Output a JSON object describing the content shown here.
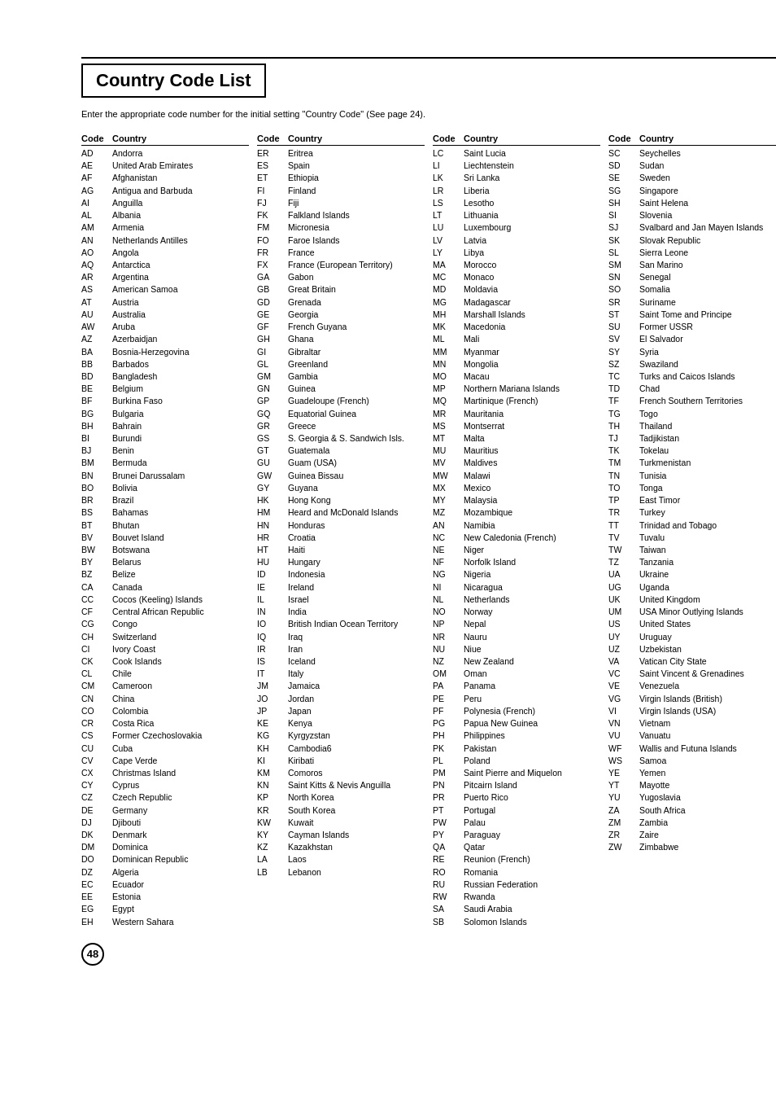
{
  "title": "Country Code List",
  "subtitle": "Enter the appropriate code number for the initial setting \"Country Code\" (See page 24).",
  "header": {
    "code": "Code",
    "country": "Country"
  },
  "page_number": "48",
  "col1": [
    {
      "code": "AD",
      "country": "Andorra"
    },
    {
      "code": "AE",
      "country": "United Arab Emirates"
    },
    {
      "code": "AF",
      "country": "Afghanistan"
    },
    {
      "code": "AG",
      "country": "Antigua and Barbuda"
    },
    {
      "code": "AI",
      "country": "Anguilla"
    },
    {
      "code": "AL",
      "country": "Albania"
    },
    {
      "code": "AM",
      "country": "Armenia"
    },
    {
      "code": "AN",
      "country": "Netherlands Antilles"
    },
    {
      "code": "AO",
      "country": "Angola"
    },
    {
      "code": "AQ",
      "country": "Antarctica"
    },
    {
      "code": "AR",
      "country": "Argentina"
    },
    {
      "code": "AS",
      "country": "American Samoa"
    },
    {
      "code": "AT",
      "country": "Austria"
    },
    {
      "code": "AU",
      "country": "Australia"
    },
    {
      "code": "AW",
      "country": "Aruba"
    },
    {
      "code": "AZ",
      "country": "Azerbaidjan"
    },
    {
      "code": "BA",
      "country": "Bosnia-Herzegovina"
    },
    {
      "code": "BB",
      "country": "Barbados"
    },
    {
      "code": "BD",
      "country": "Bangladesh"
    },
    {
      "code": "BE",
      "country": "Belgium"
    },
    {
      "code": "BF",
      "country": "Burkina Faso"
    },
    {
      "code": "BG",
      "country": "Bulgaria"
    },
    {
      "code": "BH",
      "country": "Bahrain"
    },
    {
      "code": "BI",
      "country": "Burundi"
    },
    {
      "code": "BJ",
      "country": "Benin"
    },
    {
      "code": "BM",
      "country": "Bermuda"
    },
    {
      "code": "BN",
      "country": "Brunei Darussalam"
    },
    {
      "code": "BO",
      "country": "Bolivia"
    },
    {
      "code": "BR",
      "country": "Brazil"
    },
    {
      "code": "BS",
      "country": "Bahamas"
    },
    {
      "code": "BT",
      "country": "Bhutan"
    },
    {
      "code": "BV",
      "country": "Bouvet Island"
    },
    {
      "code": "BW",
      "country": "Botswana"
    },
    {
      "code": "BY",
      "country": "Belarus"
    },
    {
      "code": "BZ",
      "country": "Belize"
    },
    {
      "code": "CA",
      "country": "Canada"
    },
    {
      "code": "CC",
      "country": "Cocos (Keeling) Islands"
    },
    {
      "code": "CF",
      "country": "Central African Republic"
    },
    {
      "code": "CG",
      "country": "Congo"
    },
    {
      "code": "CH",
      "country": "Switzerland"
    },
    {
      "code": "CI",
      "country": "Ivory Coast"
    },
    {
      "code": "CK",
      "country": "Cook Islands"
    },
    {
      "code": "CL",
      "country": "Chile"
    },
    {
      "code": "CM",
      "country": "Cameroon"
    },
    {
      "code": "CN",
      "country": "China"
    },
    {
      "code": "CO",
      "country": "Colombia"
    },
    {
      "code": "CR",
      "country": "Costa Rica"
    },
    {
      "code": "CS",
      "country": "Former Czechoslovakia"
    },
    {
      "code": "CU",
      "country": "Cuba"
    },
    {
      "code": "CV",
      "country": "Cape Verde"
    },
    {
      "code": "CX",
      "country": "Christmas Island"
    },
    {
      "code": "CY",
      "country": "Cyprus"
    },
    {
      "code": "CZ",
      "country": "Czech Republic"
    },
    {
      "code": "DE",
      "country": "Germany"
    },
    {
      "code": "DJ",
      "country": "Djibouti"
    },
    {
      "code": "DK",
      "country": "Denmark"
    },
    {
      "code": "DM",
      "country": "Dominica"
    },
    {
      "code": "DO",
      "country": "Dominican Republic"
    },
    {
      "code": "DZ",
      "country": "Algeria"
    },
    {
      "code": "EC",
      "country": "Ecuador"
    },
    {
      "code": "EE",
      "country": "Estonia"
    },
    {
      "code": "EG",
      "country": "Egypt"
    },
    {
      "code": "EH",
      "country": "Western Sahara"
    }
  ],
  "col2": [
    {
      "code": "ER",
      "country": "Eritrea"
    },
    {
      "code": "ES",
      "country": "Spain"
    },
    {
      "code": "ET",
      "country": "Ethiopia"
    },
    {
      "code": "FI",
      "country": "Finland"
    },
    {
      "code": "FJ",
      "country": "Fiji"
    },
    {
      "code": "FK",
      "country": "Falkland Islands"
    },
    {
      "code": "FM",
      "country": "Micronesia"
    },
    {
      "code": "FO",
      "country": "Faroe Islands"
    },
    {
      "code": "FR",
      "country": "France"
    },
    {
      "code": "FX",
      "country": "France (European Territory)"
    },
    {
      "code": "GA",
      "country": "Gabon"
    },
    {
      "code": "GB",
      "country": "Great Britain"
    },
    {
      "code": "GD",
      "country": "Grenada"
    },
    {
      "code": "GE",
      "country": "Georgia"
    },
    {
      "code": "GF",
      "country": "French Guyana"
    },
    {
      "code": "GH",
      "country": "Ghana"
    },
    {
      "code": "GI",
      "country": "Gibraltar"
    },
    {
      "code": "GL",
      "country": "Greenland"
    },
    {
      "code": "GM",
      "country": "Gambia"
    },
    {
      "code": "GN",
      "country": "Guinea"
    },
    {
      "code": "GP",
      "country": "Guadeloupe (French)"
    },
    {
      "code": "GQ",
      "country": "Equatorial Guinea"
    },
    {
      "code": "GR",
      "country": "Greece"
    },
    {
      "code": "GS",
      "country": "S. Georgia & S. Sandwich Isls."
    },
    {
      "code": "GT",
      "country": "Guatemala"
    },
    {
      "code": "GU",
      "country": "Guam (USA)"
    },
    {
      "code": "GW",
      "country": "Guinea Bissau"
    },
    {
      "code": "GY",
      "country": "Guyana"
    },
    {
      "code": "HK",
      "country": "Hong Kong"
    },
    {
      "code": "HM",
      "country": "Heard and McDonald Islands"
    },
    {
      "code": "HN",
      "country": "Honduras"
    },
    {
      "code": "HR",
      "country": "Croatia"
    },
    {
      "code": "HT",
      "country": "Haiti"
    },
    {
      "code": "HU",
      "country": "Hungary"
    },
    {
      "code": "ID",
      "country": "Indonesia"
    },
    {
      "code": "IE",
      "country": "Ireland"
    },
    {
      "code": "IL",
      "country": "Israel"
    },
    {
      "code": "IN",
      "country": "India"
    },
    {
      "code": "IO",
      "country": "British Indian Ocean Territory"
    },
    {
      "code": "IQ",
      "country": "Iraq"
    },
    {
      "code": "IR",
      "country": "Iran"
    },
    {
      "code": "IS",
      "country": "Iceland"
    },
    {
      "code": "IT",
      "country": "Italy"
    },
    {
      "code": "JM",
      "country": "Jamaica"
    },
    {
      "code": "JO",
      "country": "Jordan"
    },
    {
      "code": "JP",
      "country": "Japan"
    },
    {
      "code": "KE",
      "country": "Kenya"
    },
    {
      "code": "KG",
      "country": "Kyrgyzstan"
    },
    {
      "code": "KH",
      "country": "Cambodia6"
    },
    {
      "code": "KI",
      "country": "Kiribati"
    },
    {
      "code": "KM",
      "country": "Comoros"
    },
    {
      "code": "KN",
      "country": "Saint Kitts & Nevis Anguilla"
    },
    {
      "code": "KP",
      "country": "North Korea"
    },
    {
      "code": "KR",
      "country": "South Korea"
    },
    {
      "code": "KW",
      "country": "Kuwait"
    },
    {
      "code": "KY",
      "country": "Cayman Islands"
    },
    {
      "code": "KZ",
      "country": "Kazakhstan"
    },
    {
      "code": "LA",
      "country": "Laos"
    },
    {
      "code": "LB",
      "country": "Lebanon"
    }
  ],
  "col3": [
    {
      "code": "LC",
      "country": "Saint Lucia"
    },
    {
      "code": "LI",
      "country": "Liechtenstein"
    },
    {
      "code": "LK",
      "country": "Sri Lanka"
    },
    {
      "code": "LR",
      "country": "Liberia"
    },
    {
      "code": "LS",
      "country": "Lesotho"
    },
    {
      "code": "LT",
      "country": "Lithuania"
    },
    {
      "code": "LU",
      "country": "Luxembourg"
    },
    {
      "code": "LV",
      "country": "Latvia"
    },
    {
      "code": "LY",
      "country": "Libya"
    },
    {
      "code": "MA",
      "country": "Morocco"
    },
    {
      "code": "MC",
      "country": "Monaco"
    },
    {
      "code": "MD",
      "country": "Moldavia"
    },
    {
      "code": "MG",
      "country": "Madagascar"
    },
    {
      "code": "MH",
      "country": "Marshall Islands"
    },
    {
      "code": "MK",
      "country": "Macedonia"
    },
    {
      "code": "ML",
      "country": "Mali"
    },
    {
      "code": "MM",
      "country": "Myanmar"
    },
    {
      "code": "MN",
      "country": "Mongolia"
    },
    {
      "code": "MO",
      "country": "Macau"
    },
    {
      "code": "MP",
      "country": "Northern Mariana Islands"
    },
    {
      "code": "MQ",
      "country": "Martinique (French)"
    },
    {
      "code": "MR",
      "country": "Mauritania"
    },
    {
      "code": "MS",
      "country": "Montserrat"
    },
    {
      "code": "MT",
      "country": "Malta"
    },
    {
      "code": "MU",
      "country": "Mauritius"
    },
    {
      "code": "MV",
      "country": "Maldives"
    },
    {
      "code": "MW",
      "country": "Malawi"
    },
    {
      "code": "MX",
      "country": "Mexico"
    },
    {
      "code": "MY",
      "country": "Malaysia"
    },
    {
      "code": "MZ",
      "country": "Mozambique"
    },
    {
      "code": "AN",
      "country": "Namibia"
    },
    {
      "code": "NC",
      "country": "New Caledonia (French)"
    },
    {
      "code": "NE",
      "country": "Niger"
    },
    {
      "code": "NF",
      "country": "Norfolk Island"
    },
    {
      "code": "NG",
      "country": "Nigeria"
    },
    {
      "code": "NI",
      "country": "Nicaragua"
    },
    {
      "code": "NL",
      "country": "Netherlands"
    },
    {
      "code": "NO",
      "country": "Norway"
    },
    {
      "code": "NP",
      "country": "Nepal"
    },
    {
      "code": "NR",
      "country": "Nauru"
    },
    {
      "code": "NU",
      "country": "Niue"
    },
    {
      "code": "NZ",
      "country": "New Zealand"
    },
    {
      "code": "OM",
      "country": "Oman"
    },
    {
      "code": "PA",
      "country": "Panama"
    },
    {
      "code": "PE",
      "country": "Peru"
    },
    {
      "code": "PF",
      "country": "Polynesia (French)"
    },
    {
      "code": "PG",
      "country": "Papua New Guinea"
    },
    {
      "code": "PH",
      "country": "Philippines"
    },
    {
      "code": "PK",
      "country": "Pakistan"
    },
    {
      "code": "PL",
      "country": "Poland"
    },
    {
      "code": "PM",
      "country": "Saint Pierre and Miquelon"
    },
    {
      "code": "PN",
      "country": "Pitcairn Island"
    },
    {
      "code": "PR",
      "country": "Puerto Rico"
    },
    {
      "code": "PT",
      "country": "Portugal"
    },
    {
      "code": "PW",
      "country": "Palau"
    },
    {
      "code": "PY",
      "country": "Paraguay"
    },
    {
      "code": "QA",
      "country": "Qatar"
    },
    {
      "code": "RE",
      "country": "Reunion (French)"
    },
    {
      "code": "RO",
      "country": "Romania"
    },
    {
      "code": "RU",
      "country": "Russian Federation"
    },
    {
      "code": "RW",
      "country": "Rwanda"
    },
    {
      "code": "SA",
      "country": "Saudi Arabia"
    },
    {
      "code": "SB",
      "country": "Solomon Islands"
    }
  ],
  "col4": [
    {
      "code": "SC",
      "country": "Seychelles"
    },
    {
      "code": "SD",
      "country": "Sudan"
    },
    {
      "code": "SE",
      "country": "Sweden"
    },
    {
      "code": "SG",
      "country": "Singapore"
    },
    {
      "code": "SH",
      "country": "Saint Helena"
    },
    {
      "code": "SI",
      "country": "Slovenia"
    },
    {
      "code": "SJ",
      "country": "Svalbard and Jan Mayen Islands"
    },
    {
      "code": "SK",
      "country": "Slovak Republic"
    },
    {
      "code": "SL",
      "country": "Sierra Leone"
    },
    {
      "code": "SM",
      "country": "San Marino"
    },
    {
      "code": "SN",
      "country": "Senegal"
    },
    {
      "code": "SO",
      "country": "Somalia"
    },
    {
      "code": "SR",
      "country": "Suriname"
    },
    {
      "code": "ST",
      "country": "Saint Tome and Principe"
    },
    {
      "code": "SU",
      "country": "Former USSR"
    },
    {
      "code": "SV",
      "country": "El Salvador"
    },
    {
      "code": "SY",
      "country": "Syria"
    },
    {
      "code": "SZ",
      "country": "Swaziland"
    },
    {
      "code": "TC",
      "country": "Turks and Caicos Islands"
    },
    {
      "code": "TD",
      "country": "Chad"
    },
    {
      "code": "TF",
      "country": "French Southern Territories"
    },
    {
      "code": "TG",
      "country": "Togo"
    },
    {
      "code": "TH",
      "country": "Thailand"
    },
    {
      "code": "TJ",
      "country": "Tadjikistan"
    },
    {
      "code": "TK",
      "country": "Tokelau"
    },
    {
      "code": "TM",
      "country": "Turkmenistan"
    },
    {
      "code": "TN",
      "country": "Tunisia"
    },
    {
      "code": "TO",
      "country": "Tonga"
    },
    {
      "code": "TP",
      "country": "East Timor"
    },
    {
      "code": "TR",
      "country": "Turkey"
    },
    {
      "code": "TT",
      "country": "Trinidad and Tobago"
    },
    {
      "code": "TV",
      "country": "Tuvalu"
    },
    {
      "code": "TW",
      "country": "Taiwan"
    },
    {
      "code": "TZ",
      "country": "Tanzania"
    },
    {
      "code": "UA",
      "country": "Ukraine"
    },
    {
      "code": "UG",
      "country": "Uganda"
    },
    {
      "code": "UK",
      "country": "United Kingdom"
    },
    {
      "code": "UM",
      "country": "USA Minor Outlying Islands"
    },
    {
      "code": "US",
      "country": "United States"
    },
    {
      "code": "UY",
      "country": "Uruguay"
    },
    {
      "code": "UZ",
      "country": "Uzbekistan"
    },
    {
      "code": "VA",
      "country": "Vatican City State"
    },
    {
      "code": "VC",
      "country": "Saint Vincent & Grenadines"
    },
    {
      "code": "VE",
      "country": "Venezuela"
    },
    {
      "code": "VG",
      "country": "Virgin Islands (British)"
    },
    {
      "code": "VI",
      "country": "Virgin Islands (USA)"
    },
    {
      "code": "VN",
      "country": "Vietnam"
    },
    {
      "code": "VU",
      "country": "Vanuatu"
    },
    {
      "code": "WF",
      "country": "Wallis and Futuna Islands"
    },
    {
      "code": "WS",
      "country": "Samoa"
    },
    {
      "code": "YE",
      "country": "Yemen"
    },
    {
      "code": "YT",
      "country": "Mayotte"
    },
    {
      "code": "YU",
      "country": "Yugoslavia"
    },
    {
      "code": "ZA",
      "country": "South Africa"
    },
    {
      "code": "ZM",
      "country": "Zambia"
    },
    {
      "code": "ZR",
      "country": "Zaire"
    },
    {
      "code": "ZW",
      "country": "Zimbabwe"
    }
  ]
}
